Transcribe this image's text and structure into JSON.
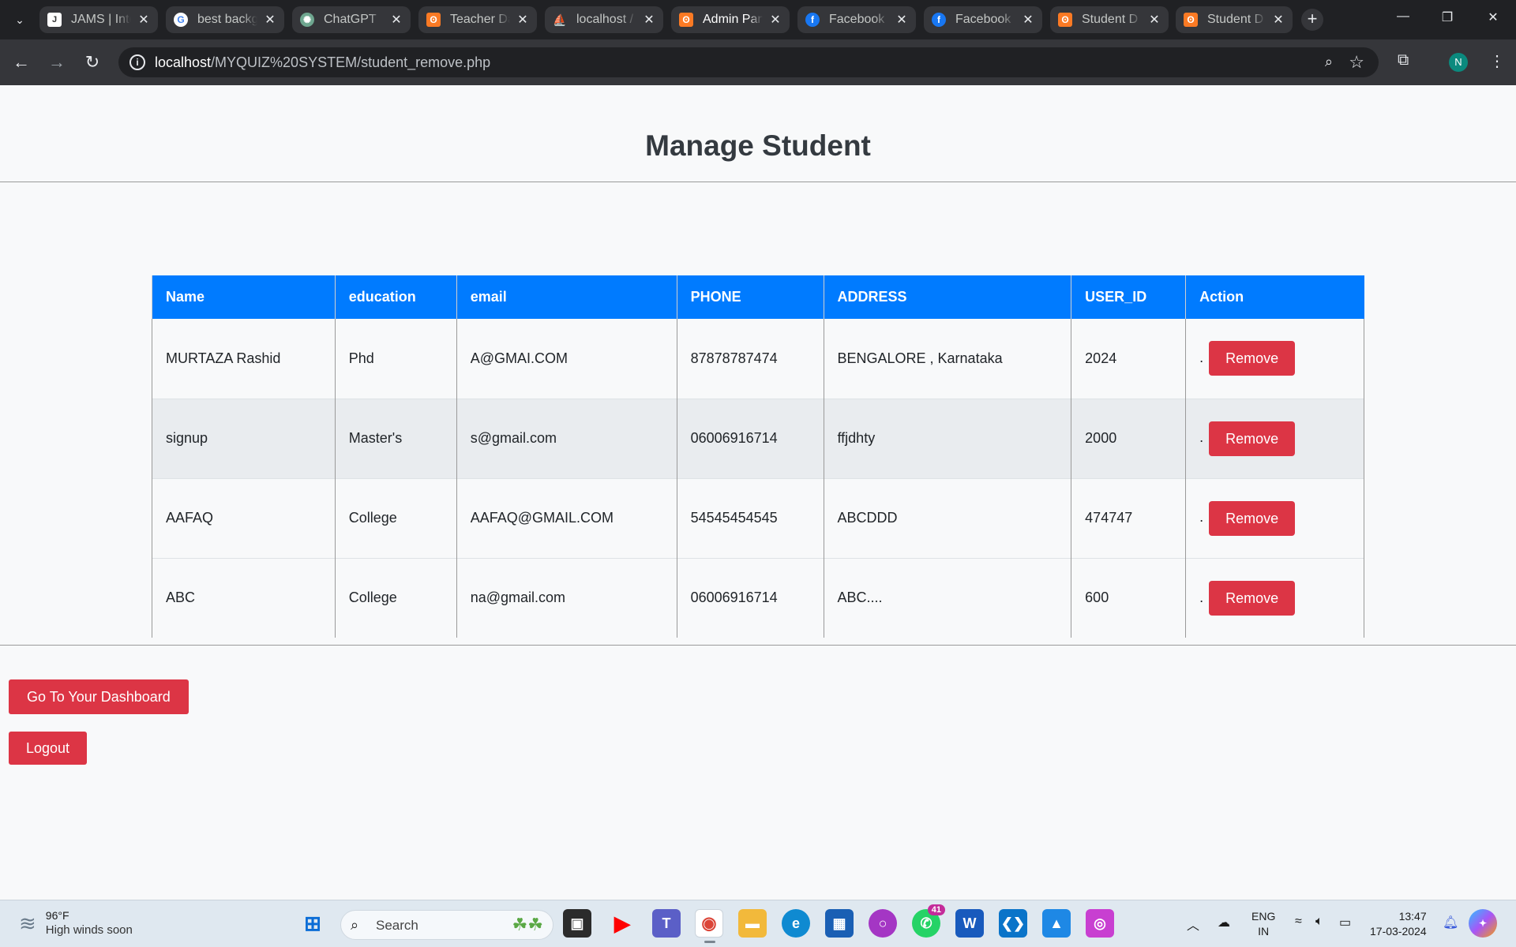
{
  "browser": {
    "tabs": [
      {
        "title": "JAMS | Inte",
        "icon": "jams-icon"
      },
      {
        "title": "best backg",
        "icon": "google-icon"
      },
      {
        "title": "ChatGPT",
        "icon": "chatgpt-icon"
      },
      {
        "title": "Teacher Da",
        "icon": "xampp-icon"
      },
      {
        "title": "localhost /",
        "icon": "phpmyadmin-icon"
      },
      {
        "title": "Admin Pan",
        "icon": "xampp-icon",
        "active": true
      },
      {
        "title": "Facebook",
        "icon": "facebook-icon"
      },
      {
        "title": "Facebook",
        "icon": "facebook-icon"
      },
      {
        "title": "Student D",
        "icon": "xampp-icon"
      },
      {
        "title": "Student D",
        "icon": "xampp-icon"
      }
    ],
    "url_host": "localhost",
    "url_path": "/MYQUIZ%20SYSTEM/student_remove.php",
    "profile_initial": "N"
  },
  "page": {
    "title": "Manage Student",
    "table": {
      "headers": [
        "Name",
        "education",
        "email",
        "PHONE",
        "ADDRESS",
        "USER_ID",
        "Action"
      ],
      "rows": [
        {
          "name": "MURTAZA Rashid",
          "education": "Phd",
          "email": "A@GMAI.COM",
          "phone": "87878787474",
          "address": "BENGALORE , Karnataka",
          "user_id": "2024"
        },
        {
          "name": "signup",
          "education": "Master's",
          "email": "s@gmail.com",
          "phone": "06006916714",
          "address": "ffjdhty",
          "user_id": "2000"
        },
        {
          "name": "AAFAQ",
          "education": "College",
          "email": "AAFAQ@GMAIL.COM",
          "phone": "54545454545",
          "address": "ABCDDD",
          "user_id": "474747"
        },
        {
          "name": "ABC",
          "education": "College",
          "email": "na@gmail.com",
          "phone": "06006916714",
          "address": "ABC....",
          "user_id": "600"
        }
      ],
      "action_prefix": ".",
      "remove_label": "Remove"
    },
    "dashboard_label": "Go To Your Dashboard",
    "logout_label": "Logout"
  },
  "taskbar": {
    "weather_temp": "96°F",
    "weather_condition": "High winds soon",
    "search_placeholder": "Search",
    "whatsapp_badge": "41",
    "lang_line1": "ENG",
    "lang_line2": "IN",
    "time": "13:47",
    "date": "17-03-2024"
  },
  "colors": {
    "header_blue": "#007bff",
    "danger_red": "#dc3545",
    "title_dark": "#343a40"
  }
}
